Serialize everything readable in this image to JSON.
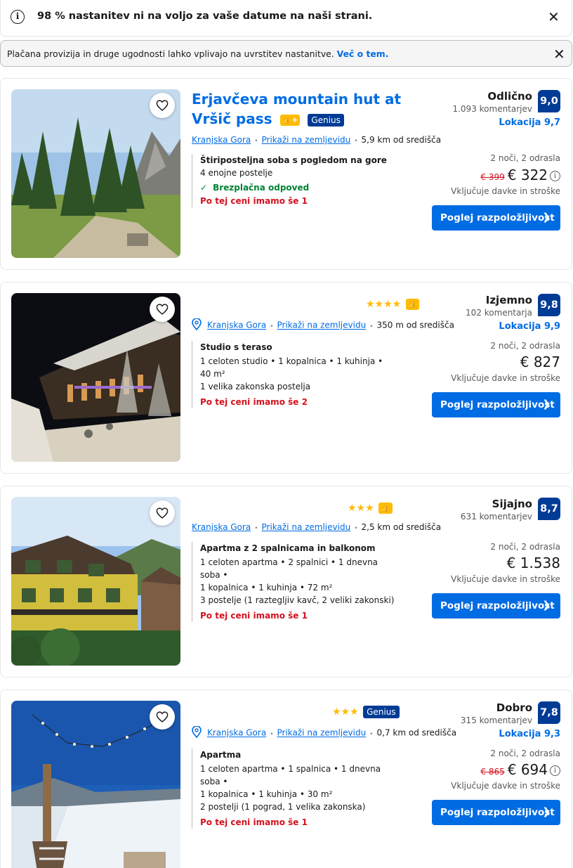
{
  "banner_notice": {
    "text": "98 % nastanitev ni na voljo za vaše datume na naši strani."
  },
  "banner_commission": {
    "text": "Plačana provizija in druge ugodnosti lahko vplivajo na uvrstitev nastanitve. ",
    "link": "Več o tem."
  },
  "colors": {
    "primary": "#006ce4",
    "score_bg": "#003b95",
    "star": "#febb02",
    "alert": "#d4111e",
    "success": "#008234"
  },
  "listings": [
    {
      "title": "Erjavčeva mountain hut at Vršič pass",
      "badges": [
        "like-plus-badge",
        "Genius"
      ],
      "genius_label": "Genius",
      "location": "Kranjska Gora",
      "map_link": "Prikaži na zemljevidu",
      "distance": "5,9 km od središča",
      "room_title": "Štiriposteljna soba s pogledom na gore",
      "room_lines": [
        "4 enojne postelje"
      ],
      "free_cancel": "Brezplačna odpoved",
      "availability": "Po tej ceni imamo še 1",
      "score_word": "Odlično",
      "reviews": "1.093 komentarjev",
      "score": "9,0",
      "location_score": "Lokacija 9,7",
      "nights": "2 noči, 2 odrasla",
      "old_price": "€ 399",
      "price": "€ 322",
      "taxes": "Vključuje davke in stroške",
      "button": "Poglej razpoložljivost"
    },
    {
      "stars": "★★★★",
      "location": "Kranjska Gora",
      "map_link": "Prikaži na zemljevidu",
      "distance": "350 m od središča",
      "room_title": "Studio s teraso",
      "room_lines": [
        "1 celoten studio • 1 kopalnica • 1 kuhinja • 40 m²",
        "1 velika zakonska postelja"
      ],
      "availability": "Po tej ceni imamo še 2",
      "score_word": "Izjemno",
      "reviews": "102 komentarja",
      "score": "9,8",
      "location_score": "Lokacija 9,9",
      "nights": "2 noči, 2 odrasla",
      "price": "€ 827",
      "taxes": "Vključuje davke in stroške",
      "button": "Poglej razpoložljivost"
    },
    {
      "stars": "★★★",
      "location": "Kranjska Gora",
      "map_link": "Prikaži na zemljevidu",
      "distance": "2,5 km od središča",
      "room_title": "Apartma z 2 spalnicama in balkonom",
      "room_lines": [
        "1 celoten apartma • 2 spalnici • 1 dnevna soba •",
        "1 kopalnica • 1 kuhinja • 72 m²",
        "3 postelje (1 raztegljiv kavč, 2 veliki zakonski)"
      ],
      "availability": "Po tej ceni imamo še 1",
      "score_word": "Sijajno",
      "reviews": "631 komentarjev",
      "score": "8,7",
      "nights": "2 noči, 2 odrasla",
      "price": "€ 1.538",
      "taxes": "Vključuje davke in stroške",
      "button": "Poglej razpoložljivost"
    },
    {
      "stars": "★★★",
      "genius_label": "Genius",
      "location": "Kranjska Gora",
      "map_link": "Prikaži na zemljevidu",
      "distance": "0,7 km od središča",
      "room_title": "Apartma",
      "room_lines": [
        "1 celoten apartma • 1 spalnica • 1 dnevna soba •",
        "1 kopalnica • 1 kuhinja • 30 m²",
        "2 postelji (1 pograd, 1 velika zakonska)"
      ],
      "availability": "Po tej ceni imamo še 1",
      "score_word": "Dobro",
      "reviews": "315 komentarjev",
      "score": "7,8",
      "location_score": "Lokacija 9,3",
      "nights": "2 noči, 2 odrasla",
      "old_price": "€ 865",
      "price": "€ 694",
      "taxes": "Vključuje davke in stroške",
      "button": "Poglej razpoložljivost"
    }
  ]
}
